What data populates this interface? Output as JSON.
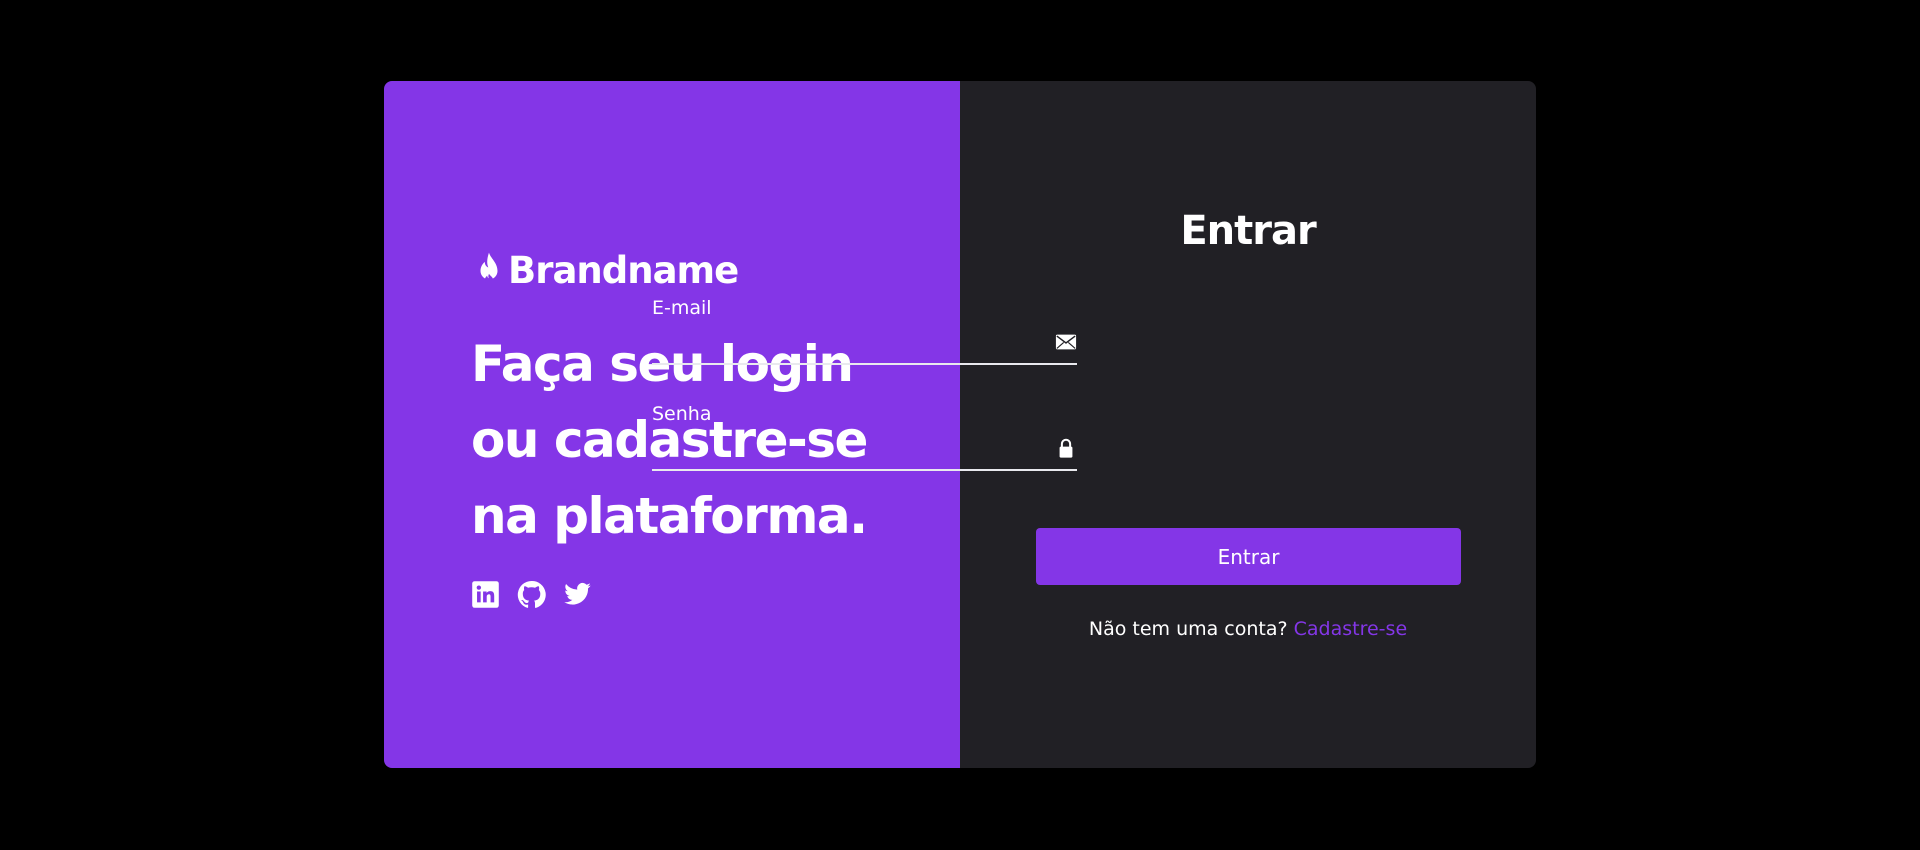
{
  "brand": {
    "icon": "flame-icon",
    "name": "Brandname"
  },
  "hero": {
    "line1": "Faça seu login",
    "line2": "ou cadastre-se",
    "line3": "na plataforma."
  },
  "socials": [
    {
      "icon": "linkedin-icon"
    },
    {
      "icon": "github-icon"
    },
    {
      "icon": "twitter-icon"
    }
  ],
  "form": {
    "title": "Entrar",
    "email_label": "E-mail",
    "email_value": "",
    "email_icon": "envelope-icon",
    "password_label": "Senha",
    "password_value": "",
    "password_icon": "lock-icon",
    "submit_label": "Entrar",
    "signup_prompt": "Não tem uma conta?",
    "signup_link": "Cadastre-se"
  },
  "colors": {
    "background": "#000000",
    "accent": "#8436e7",
    "panel_dark": "#212025",
    "text": "#ffffff"
  }
}
